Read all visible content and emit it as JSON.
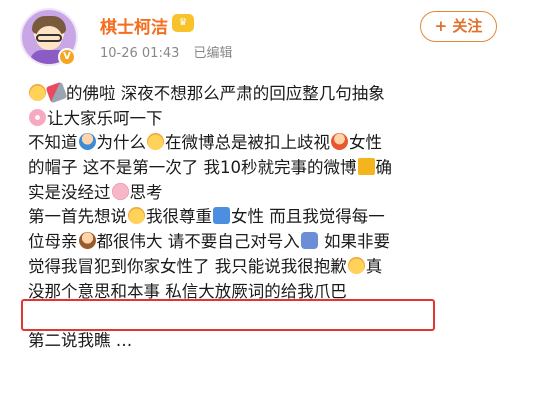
{
  "header": {
    "username": "棋士柯洁",
    "badge_icon": "crown-badge-icon",
    "timestamp": "10-26 01:43",
    "edited": "已编辑",
    "follow_label": "+ 关注",
    "verified_icon": "verified-v-icon"
  },
  "post": {
    "lines": [
      {
        "parts": [
          {
            "emoji": "face"
          },
          {
            "emoji": "lipstick"
          },
          {
            "text": "的佛啦  深夜不想那么严肃的回应整几句抽象"
          }
        ]
      },
      {
        "parts": [
          {
            "emoji": "flower"
          },
          {
            "text": "让大家乐呵一下"
          }
        ]
      },
      {
        "parts": [
          {
            "text": "不知道"
          },
          {
            "emoji": "man"
          },
          {
            "text": "为什么"
          },
          {
            "emoji": "face"
          },
          {
            "text": "在微博总是被扣上歧视"
          },
          {
            "emoji": "woman"
          },
          {
            "text": "女性"
          }
        ]
      },
      {
        "parts": [
          {
            "text": "的帽子  这不是第一次了  我10秒就完事的微博"
          },
          {
            "emoji": "book"
          },
          {
            "text": "确"
          }
        ]
      },
      {
        "parts": [
          {
            "text": "实是没经过"
          },
          {
            "emoji": "brain"
          },
          {
            "text": "思考"
          }
        ]
      },
      {
        "parts": [
          {
            "text": " 第一首先想说"
          },
          {
            "emoji": "face"
          },
          {
            "text": "我很尊重"
          },
          {
            "emoji": "wc"
          },
          {
            "text": "女性  而且我觉得每一"
          }
        ]
      },
      {
        "parts": [
          {
            "text": "位母亲"
          },
          {
            "emoji": "mother"
          },
          {
            "text": "都很伟大  请不要自己对号入"
          },
          {
            "emoji": "bag"
          },
          {
            "text": "  如果非要"
          }
        ]
      },
      {
        "parts": [
          {
            "text": "觉得我冒犯到你家女性了  我只能说我很抱歉"
          },
          {
            "emoji": "face"
          },
          {
            "text": "真"
          }
        ]
      },
      {
        "parts": [
          {
            "text": "没那个意思和本事  私信大放厥词的给我爪巴"
          }
        ]
      },
      {
        "parts": [
          {
            "text": ""
          }
        ]
      },
      {
        "parts": [
          {
            "text": "第二说我瞧 …"
          }
        ]
      }
    ]
  },
  "colors": {
    "username": "#f56d1d",
    "follow_border": "#e08a3a",
    "highlight_box": "#e33434",
    "meta_text": "#888888"
  }
}
